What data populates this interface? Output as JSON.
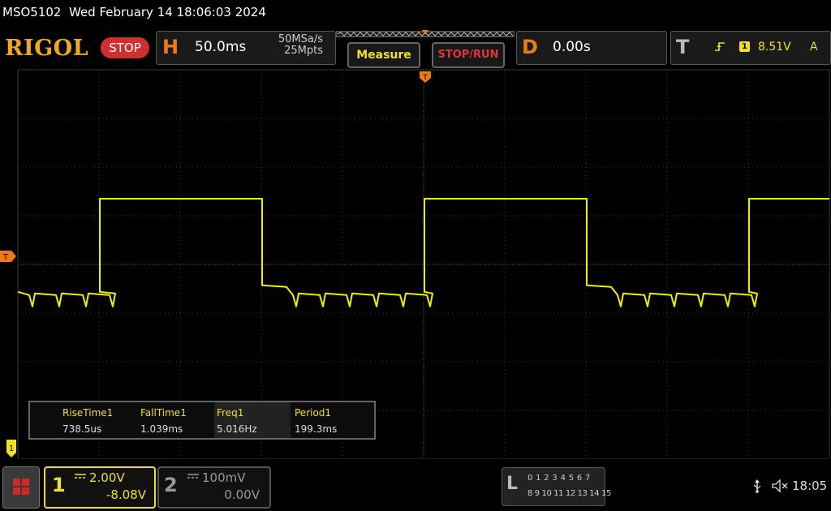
{
  "title_bar": {
    "model": "MSO5102",
    "datetime": "Wed February 14 18:06:03 2024"
  },
  "header": {
    "logo": "RIGOL",
    "run_state": "STOP",
    "horizontal": {
      "letter": "H",
      "timebase": "50.0ms",
      "sample_rate": "50MSa/s",
      "memory_depth": "25Mpts"
    },
    "measure_button": "Measure",
    "stop_run_button": "STOP/RUN",
    "delay": {
      "letter": "D",
      "value": "0.00s"
    },
    "trigger": {
      "letter": "T",
      "edge_icon": "rising-edge-icon",
      "source": "1",
      "level": "8.51V",
      "mode": "A"
    }
  },
  "screen": {
    "trigger_marker": "T",
    "channel_marker": "1",
    "trace_color": "#f0f000",
    "waveform": {
      "type": "square",
      "period_ms": 199.3,
      "duty_fraction": 0.5,
      "high_level_divs": 1.35,
      "low_level_divs": -0.75
    }
  },
  "measurements": {
    "items": [
      {
        "name": "RiseTime1",
        "value": "738.5us"
      },
      {
        "name": "FallTime1",
        "value": "1.039ms"
      },
      {
        "name": "Freq1",
        "value": "5.016Hz"
      },
      {
        "name": "Period1",
        "value": "199.3ms"
      }
    ]
  },
  "bottom": {
    "ch1": {
      "number": "1",
      "coupling": "DC",
      "scale": "2.00V",
      "offset": "-8.08V"
    },
    "ch2": {
      "number": "2",
      "coupling": "DC",
      "scale": "100mV",
      "offset": "0.00V"
    },
    "la": {
      "letter": "L",
      "row1": "0 1 2 3  4 5 6 7",
      "row2": "8 9 10 11 12 13 14 15"
    },
    "clock": "18:05"
  },
  "colors": {
    "accent_orange": "#f07a10",
    "ch1_yellow": "#f0e020",
    "stop_red": "#cf3030"
  }
}
